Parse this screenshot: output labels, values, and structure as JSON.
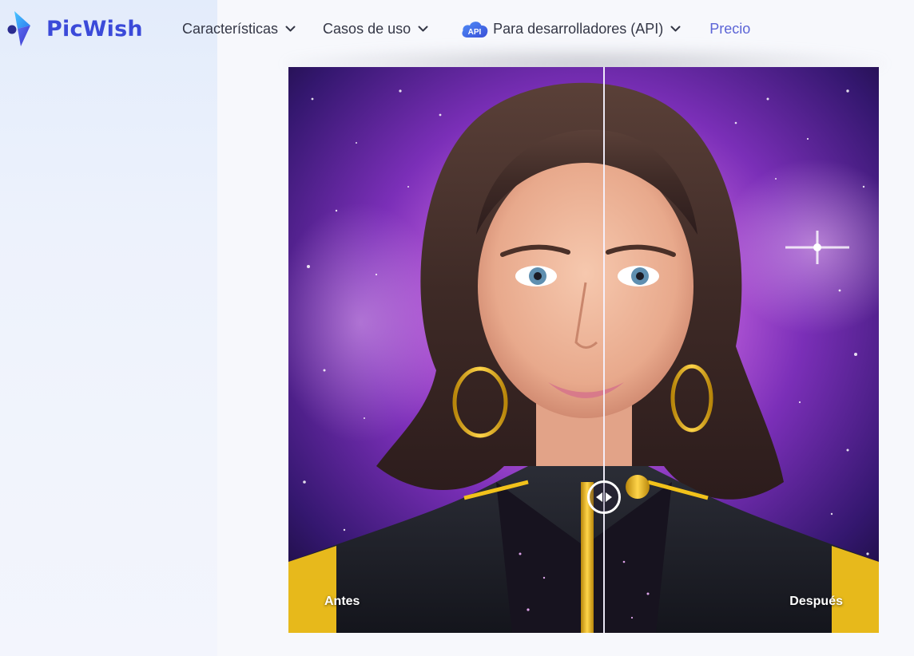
{
  "brand": {
    "name": "PicWish",
    "color": "#3b4ad9"
  },
  "nav": {
    "features_label": "Características",
    "use_cases_label": "Casos de uso",
    "api_badge": "API",
    "developers_label": "Para desarrolladores (API)",
    "pricing_label": "Precio",
    "pricing_color": "#5b64d6"
  },
  "comparison": {
    "before_label": "Antes",
    "after_label": "Después",
    "slider_position": 0.535
  },
  "icons": {
    "logo": "picwish-logo-icon",
    "dropdown": "chevron-down-icon",
    "api": "api-cloud-icon",
    "handle": "left-right-arrows-icon"
  }
}
